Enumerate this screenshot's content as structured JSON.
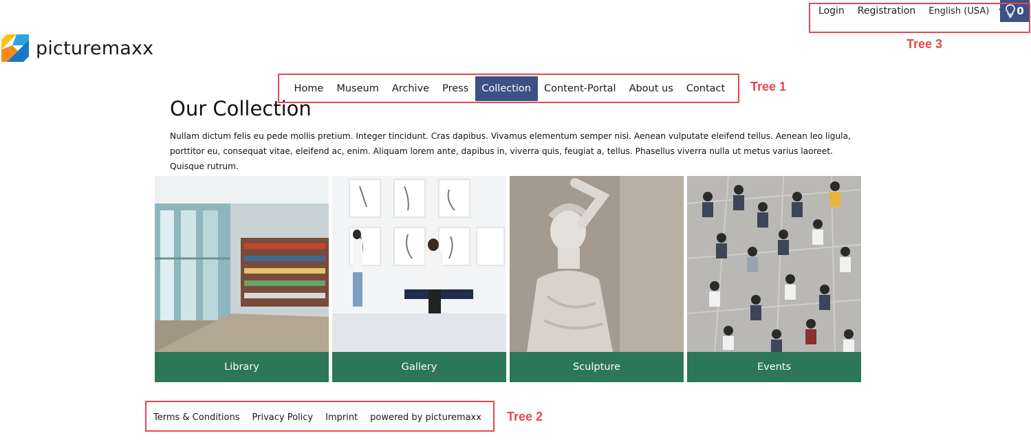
{
  "topbar": {
    "login": "Login",
    "registration": "Registration",
    "language": "English (USA)",
    "lightbox_count": "0"
  },
  "logo": {
    "text": "picturemaxx"
  },
  "nav": {
    "items": [
      "Home",
      "Museum",
      "Archive",
      "Press",
      "Collection",
      "Content-Portal",
      "About us",
      "Contact"
    ],
    "active": "Collection"
  },
  "page": {
    "title": "Our Collection",
    "description": "Nullam dictum felis eu pede mollis pretium. Integer tincidunt. Cras dapibus. Vivamus elementum semper nisi. Aenean vulputate eleifend tellus. Aenean leo ligula, porttitor eu, consequat vitae, eleifend ac, enim. Aliquam lorem ante, dapibus in, viverra quis, feugiat a, tellus. Phasellus viverra nulla ut metus varius laoreet. Quisque rutrum."
  },
  "tiles": [
    {
      "label": "Library"
    },
    {
      "label": "Gallery"
    },
    {
      "label": "Sculpture"
    },
    {
      "label": "Events"
    }
  ],
  "footer": {
    "terms": "Terms & Conditions",
    "privacy": "Privacy Policy",
    "imprint": "Imprint",
    "powered": "powered by picturemaxx"
  },
  "annotations": {
    "tree1": "Tree 1",
    "tree2": "Tree 2",
    "tree3": "Tree 3"
  },
  "colors": {
    "primary": "#3a5286",
    "tile_label": "#2b7758",
    "annotation": "#e5484d"
  }
}
